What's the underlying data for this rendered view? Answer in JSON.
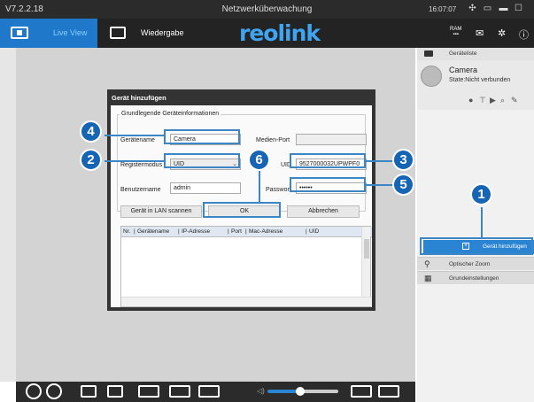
{
  "app": {
    "version": "V7.2.2.18",
    "window_title": "Netzwerküberwachung",
    "clock": "16:07:07",
    "logo": "reolink"
  },
  "nav": {
    "live_view": "Live View",
    "playback": "Wiedergabe",
    "ram_label": "RAM"
  },
  "sidebar": {
    "device_list": "Geräteliste",
    "camera_name": "Camera",
    "camera_state": "State:Nicht verbunden",
    "add_device": "Gerät hinzufügen",
    "optical_zoom": "Optischer Zoom",
    "basic_settings": "Grundeinstellungen"
  },
  "dialog": {
    "title": "Gerät hinzufügen",
    "group_label": "Grundlegende Geräteinformationen",
    "device_name_label": "Gerätename",
    "device_name_value": "Camera",
    "media_port_label": "Medien-Port",
    "media_port_value": "",
    "register_mode_label": "Registermodus",
    "register_mode_value": "UID",
    "uid_label": "UID",
    "uid_value": "9527000032UPWPF0",
    "username_label": "Benutzername",
    "username_value": "admin",
    "password_label": "Passwort",
    "password_value": "••••••",
    "scan_lan_button": "Gerät in LAN scannen",
    "ok_button": "OK",
    "cancel_button": "Abbrechen",
    "table_headers": [
      "Nr.",
      "Gerätename",
      "IP-Adresse",
      "Port",
      "Mac-Adresse",
      "UID"
    ]
  },
  "callouts": [
    "1",
    "2",
    "3",
    "4",
    "5",
    "6"
  ],
  "colors": {
    "accent": "#2a84d2",
    "callout": "#1565b4",
    "titlebar": "#2b2b2b"
  }
}
